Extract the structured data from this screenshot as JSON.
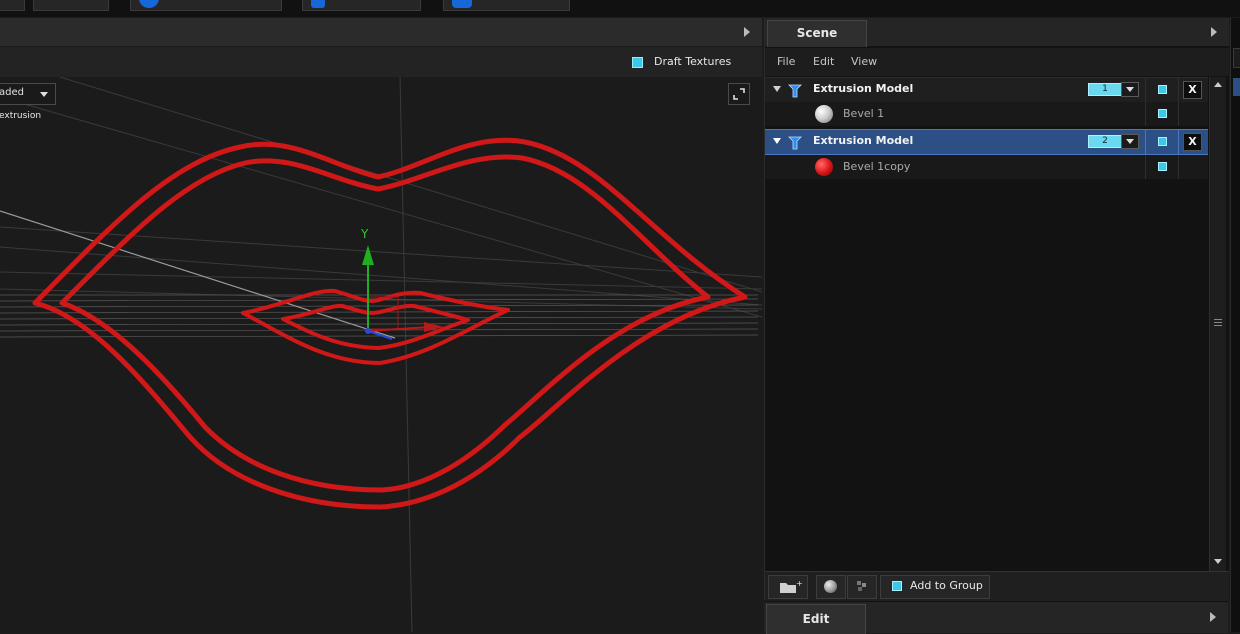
{
  "viewport": {
    "draft_textures_label": "Draft Textures",
    "draft_textures_checked": true,
    "shading_mode": "aded",
    "object_label": "extrusion",
    "gizmo_axis_label": "Y",
    "model_color": "#d01818"
  },
  "scene": {
    "tab_label": "Scene",
    "menu": [
      "File",
      "Edit",
      "View"
    ],
    "rows": [
      {
        "type": "model",
        "name": "Extrusion Model",
        "number": "1",
        "selected": false,
        "visible": true,
        "delete_label": "X"
      },
      {
        "type": "material",
        "name": "Bevel 1",
        "swatch_color": "#e8e8e8",
        "visible": true
      },
      {
        "type": "model",
        "name": "Extrusion Model",
        "number": "2",
        "selected": true,
        "visible": true,
        "delete_label": "X"
      },
      {
        "type": "material",
        "name": "Bevel 1copy",
        "swatch_color": "#e01818",
        "visible": true
      }
    ],
    "add_to_group_label": "Add to Group",
    "add_to_group_checked": true
  },
  "edit": {
    "tab_label": "Edit"
  },
  "colors": {
    "accent": "#3cc8e8",
    "selection": "#2c4f86",
    "extrusion_red": "#d01818"
  }
}
